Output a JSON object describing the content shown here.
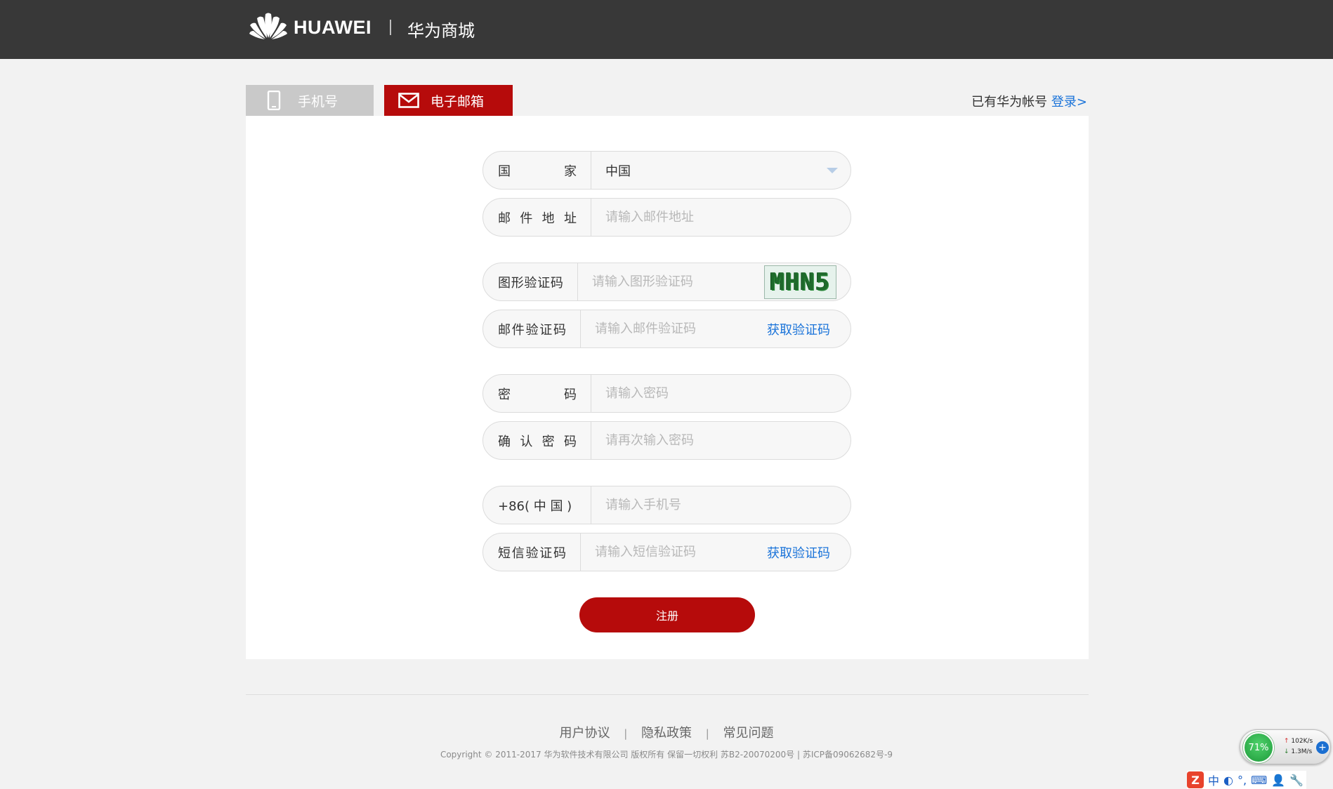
{
  "header": {
    "brand": "HUAWEI",
    "separator": "|",
    "mall_title": "华为商城"
  },
  "tabs": [
    {
      "label": "手机号",
      "icon": "phone-icon",
      "active": false
    },
    {
      "label": "电子邮箱",
      "icon": "mail-icon",
      "active": true
    }
  ],
  "login_hint": {
    "text": "已有华为帐号",
    "link": "登录>"
  },
  "form": {
    "country": {
      "label_chars": [
        "国",
        "家"
      ],
      "value": "中国"
    },
    "email": {
      "label_chars": [
        "邮",
        "件",
        "地",
        "址"
      ],
      "placeholder": "请输入邮件地址"
    },
    "captcha": {
      "label_chars": [
        "图",
        "形",
        "验",
        "证",
        "码"
      ],
      "placeholder": "请输入图形验证码",
      "image_text": "MHN5"
    },
    "email_code": {
      "label_chars": [
        "邮",
        "件",
        "验",
        "证",
        "码"
      ],
      "placeholder": "请输入邮件验证码",
      "action": "获取验证码"
    },
    "password": {
      "label_chars": [
        "密",
        "码"
      ],
      "placeholder": "请输入密码"
    },
    "confirm_password": {
      "label_chars": [
        "确",
        "认",
        "密",
        "码"
      ],
      "placeholder": "请再次输入密码"
    },
    "phone": {
      "label": "+86( 中 国 )",
      "placeholder": "请输入手机号"
    },
    "sms_code": {
      "label_chars": [
        "短",
        "信",
        "验",
        "证",
        "码"
      ],
      "placeholder": "请输入短信验证码",
      "action": "获取验证码"
    },
    "submit": "注册"
  },
  "footer": {
    "links": [
      "用户协议",
      "隐私政策",
      "常见问题"
    ],
    "link_separator": "|",
    "copyright": "Copyright © 2011-2017  华为软件技术有限公司  版权所有  保留一切权利  苏B2-20070200号 | 苏ICP备09062682号-9"
  },
  "system_tray": {
    "network_percent": "71%",
    "upload": "102K/s",
    "download": "1.3M/s",
    "ime_chars": [
      "中",
      "◐",
      "°,",
      "⌨",
      "👤",
      "🔧"
    ]
  },
  "colors": {
    "header_bg": "#383838",
    "accent_red": "#b60b0b",
    "link_blue": "#1a73d9",
    "page_bg": "#f2f2f2"
  }
}
